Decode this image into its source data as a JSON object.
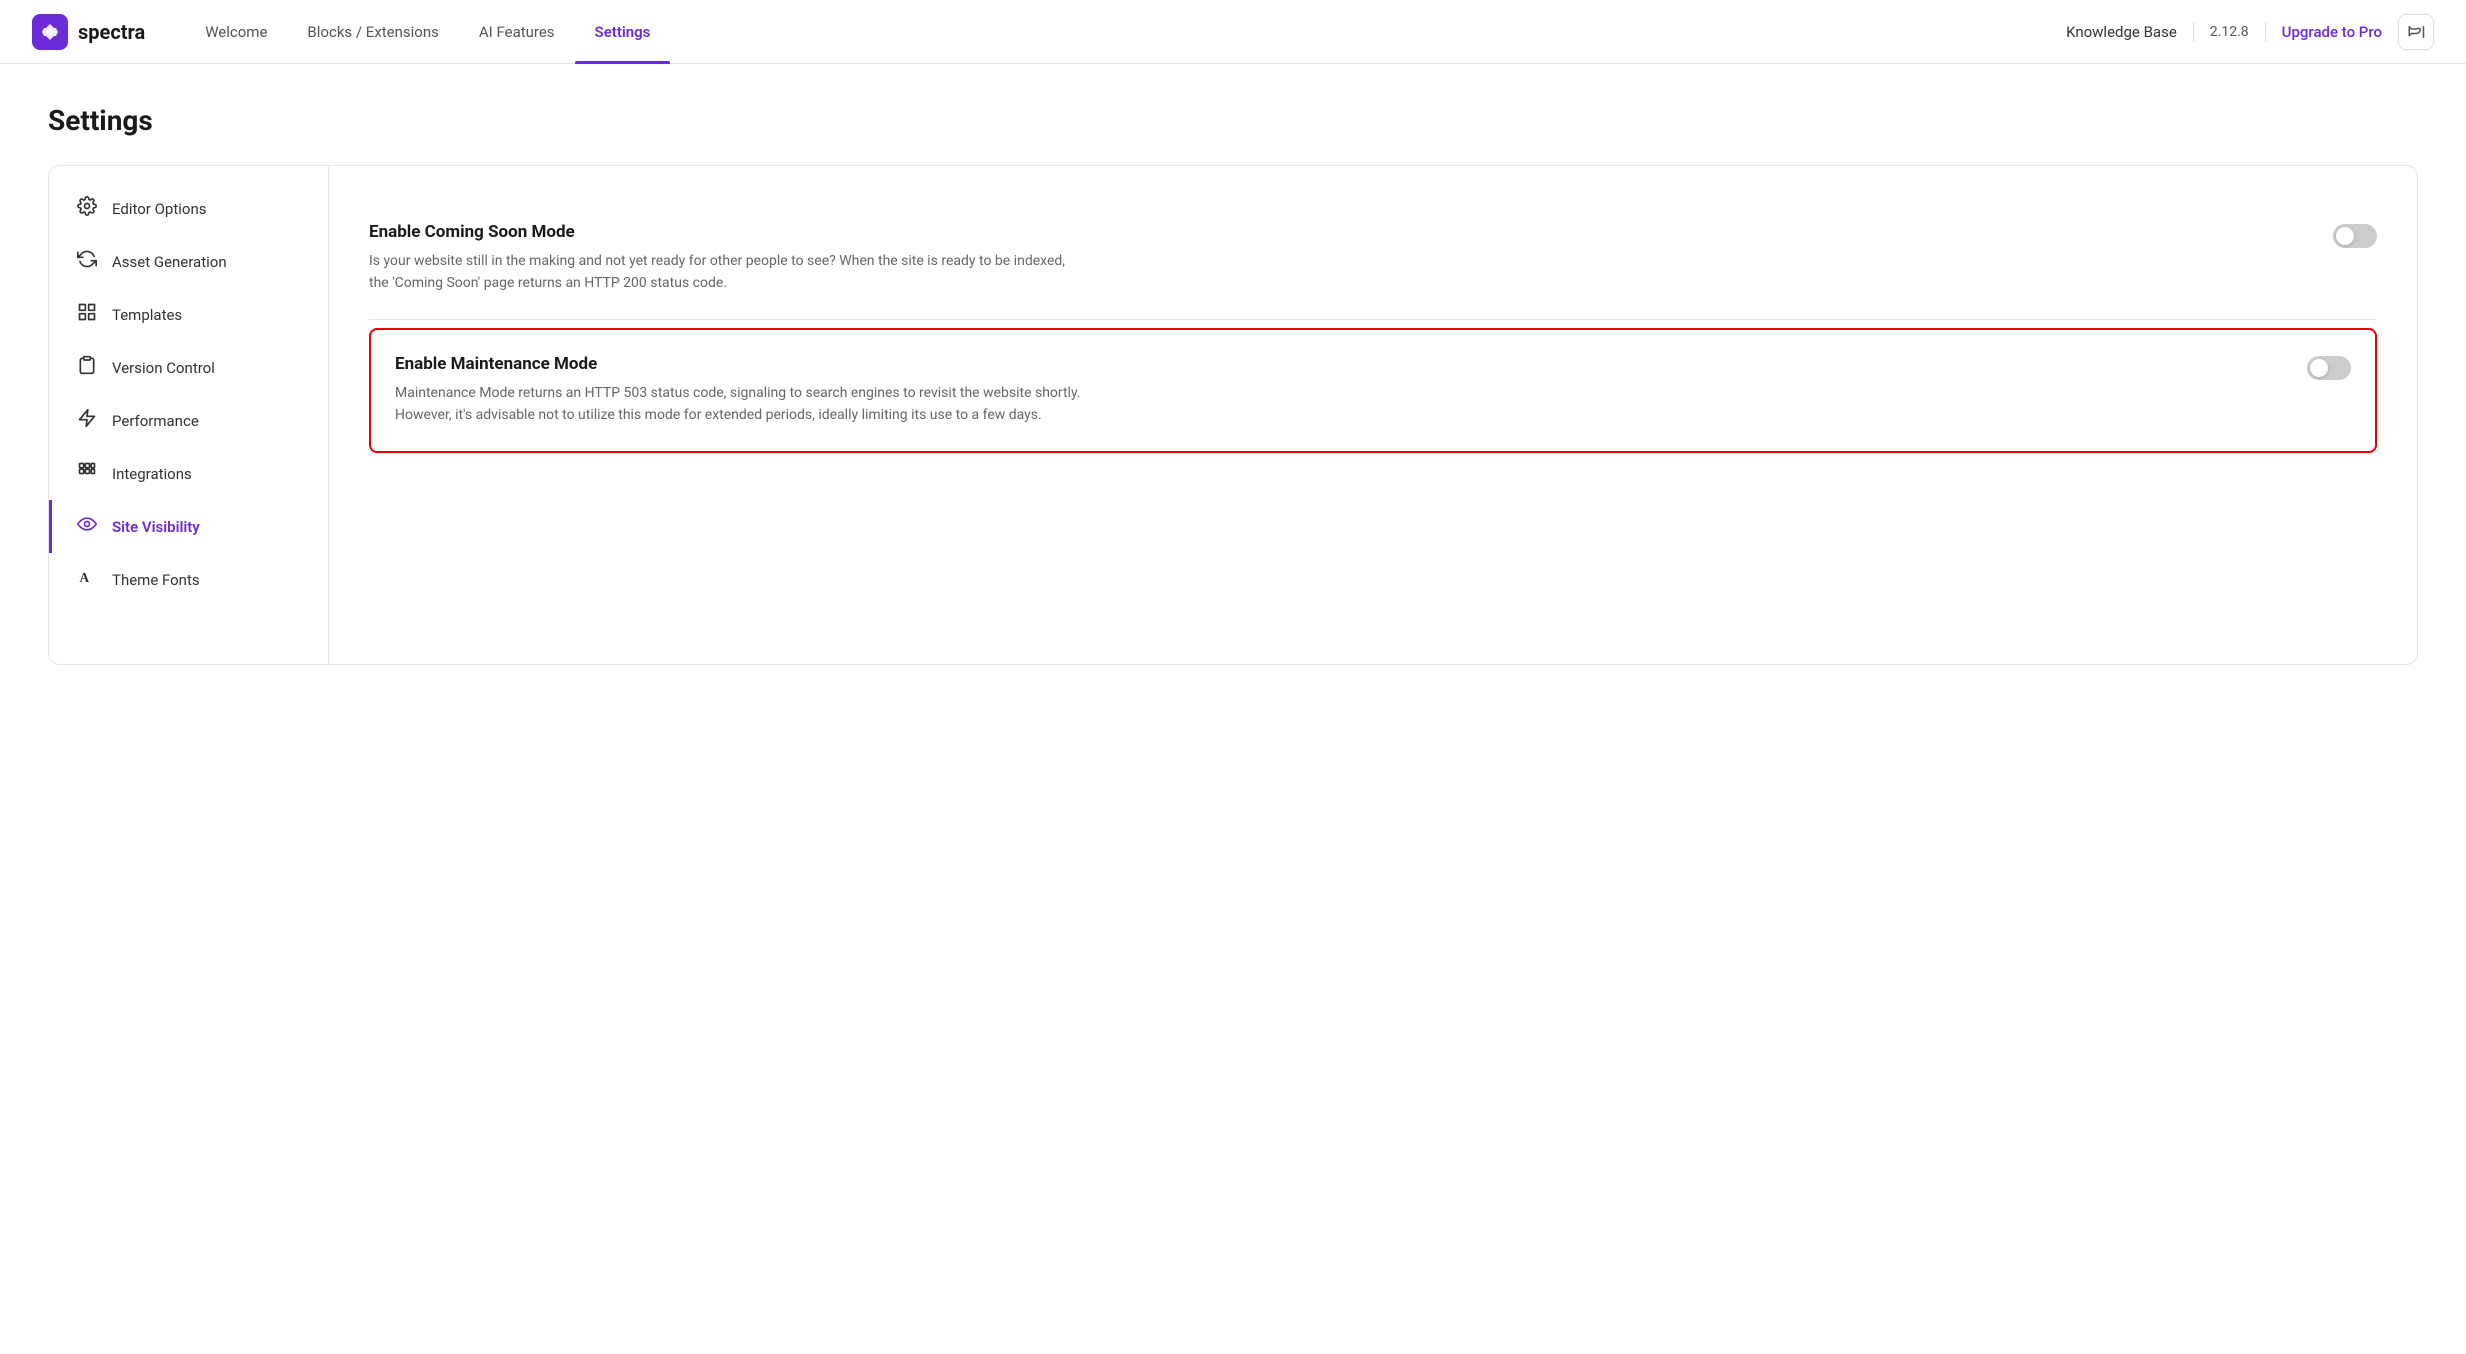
{
  "logo": {
    "symbol": "S",
    "name": "spectra"
  },
  "nav": {
    "links": [
      {
        "id": "welcome",
        "label": "Welcome",
        "active": false
      },
      {
        "id": "blocks-extensions",
        "label": "Blocks / Extensions",
        "active": false
      },
      {
        "id": "ai-features",
        "label": "AI Features",
        "active": false
      },
      {
        "id": "settings",
        "label": "Settings",
        "active": true
      }
    ],
    "right": {
      "knowledge_base": "Knowledge Base",
      "version": "2.12.8",
      "upgrade": "Upgrade to Pro"
    }
  },
  "page": {
    "title": "Settings"
  },
  "sidebar": {
    "items": [
      {
        "id": "editor-options",
        "label": "Editor Options",
        "icon": "gear",
        "active": false
      },
      {
        "id": "asset-generation",
        "label": "Asset Generation",
        "icon": "refresh",
        "active": false
      },
      {
        "id": "templates",
        "label": "Templates",
        "icon": "grid",
        "active": false
      },
      {
        "id": "version-control",
        "label": "Version Control",
        "icon": "clipboard",
        "active": false
      },
      {
        "id": "performance",
        "label": "Performance",
        "icon": "bolt",
        "active": false
      },
      {
        "id": "integrations",
        "label": "Integrations",
        "icon": "apps",
        "active": false
      },
      {
        "id": "site-visibility",
        "label": "Site Visibility",
        "icon": "eye",
        "active": true
      },
      {
        "id": "theme-fonts",
        "label": "Theme Fonts",
        "icon": "font",
        "active": false
      }
    ]
  },
  "settings": {
    "coming_soon": {
      "label": "Enable Coming Soon Mode",
      "desc": "Is your website still in the making and not yet ready for other people to see? When the site is ready to be indexed, the 'Coming Soon' page returns an HTTP 200 status code.",
      "enabled": false
    },
    "maintenance": {
      "label": "Enable Maintenance Mode",
      "desc": "Maintenance Mode returns an HTTP 503 status code, signaling to search engines to revisit the website shortly. However, it's advisable not to utilize this mode for extended periods, ideally limiting its use to a few days.",
      "enabled": false,
      "highlighted": true
    }
  }
}
